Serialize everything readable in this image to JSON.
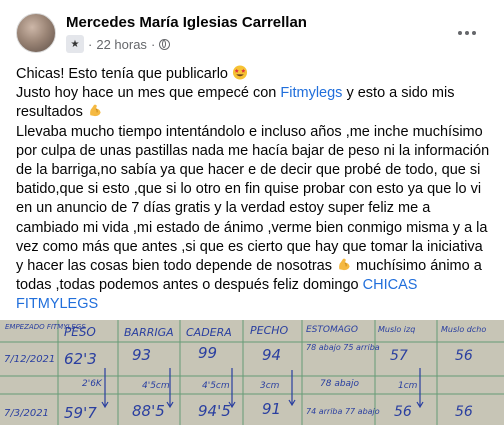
{
  "post": {
    "author": "Mercedes María Iglesias Carrellan",
    "time": "22 horas",
    "separator": "·",
    "line1": "Chicas! Esto tenía que publicarlo",
    "line2_pre": "Justo hoy hace un mes que empecé con ",
    "brand_link": "Fitmylegs",
    "line2_post": "  y esto a sido mis resultados",
    "body": "Llevaba mucho tiempo intentándolo e incluso años ,me inche muchísimo por culpa de unas pastillas nada me hacía bajar de peso ni la información de la barriga,no sabía ya que hacer e de decir que probé de todo, que si batido,que si esto ,que si lo otro en fin quise probar con esto ya que lo vi en un anuncio de 7 días gratis y la verdad estoy super feliz me a cambiado mi vida ,mi estado de ánimo ,verme bien conmigo misma y a la vez como más que antes ,si que es cierto que hay que tomar la iniciativa y hacer las cosas bien todo depende de nosotras",
    "body_end": " muchísimo ánimo a todas ,todas podemos antes o después feliz domingo ",
    "hashtag_link": "CHICAS FITMYLEGS",
    "emoji_names": [
      "star-struck-emoji",
      "flexed-biceps-emoji"
    ]
  },
  "photo": {
    "headers": [
      "EMPEZADO FITMYLEGS",
      "PESO",
      "BARRIGA",
      "CADERA",
      "PECHO",
      "ESTOMAGO",
      "Muslo izq",
      "Muslo dcho"
    ],
    "row1": [
      "7/12/2021",
      "62'3",
      "93",
      "99",
      "94",
      "78 abajo 75 arriba",
      "57",
      "56"
    ],
    "diffs": [
      "2'6K",
      "4'5cm",
      "4'5cm",
      "3cm",
      "78 abajo",
      "1cm",
      ""
    ],
    "row2": [
      "7/3/2021",
      "59'7",
      "88'5",
      "94'5",
      "91",
      "74 arriba 77 abajo",
      "56",
      "56"
    ],
    "colors": {
      "ink": "#2a3fa0",
      "paper": "#c6c4b5",
      "grid": "#3c8a5c"
    }
  }
}
